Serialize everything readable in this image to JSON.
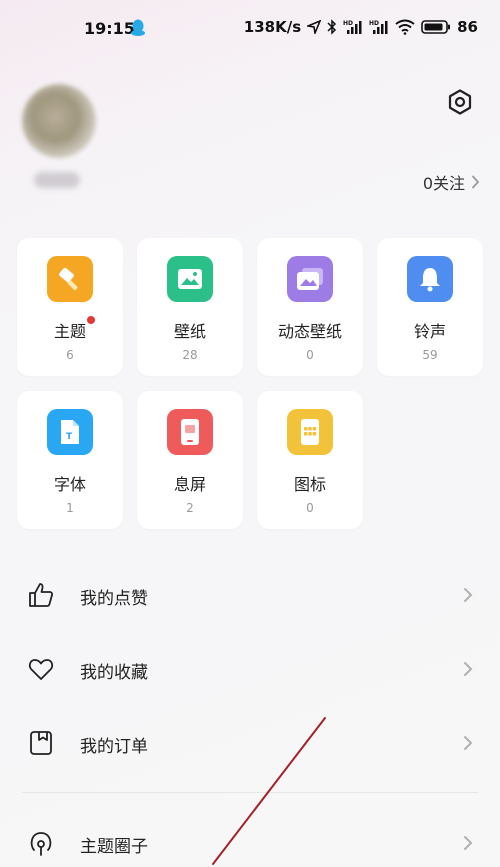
{
  "status_bar": {
    "time": "19:15",
    "net_speed": "138K/s",
    "battery": "86",
    "icons": [
      "qq-icon",
      "location-icon",
      "bluetooth-icon",
      "signal-hd-icon",
      "signal-hd-icon",
      "wifi-icon",
      "battery-icon"
    ]
  },
  "profile": {
    "follow_text": "0关注"
  },
  "categories": [
    {
      "label": "主题",
      "count": "6",
      "color": "#f5a623",
      "icon": "theme-brush-icon",
      "has_dot": true
    },
    {
      "label": "壁纸",
      "count": "28",
      "color": "#2bbf8a",
      "icon": "wallpaper-icon"
    },
    {
      "label": "动态壁纸",
      "count": "0",
      "color": "#9d7ce6",
      "icon": "live-wallpaper-icon"
    },
    {
      "label": "铃声",
      "count": "59",
      "color": "#4f8ef0",
      "icon": "bell-icon"
    },
    {
      "label": "字体",
      "count": "1",
      "color": "#2aa7f2",
      "icon": "font-icon"
    },
    {
      "label": "息屏",
      "count": "2",
      "color": "#ef5b5b",
      "icon": "aod-icon"
    },
    {
      "label": "图标",
      "count": "0",
      "color": "#f2c23a",
      "icon": "app-icons-icon"
    }
  ],
  "menu": [
    {
      "label": "我的点赞",
      "icon": "thumbs-up-icon"
    },
    {
      "label": "我的收藏",
      "icon": "heart-icon"
    },
    {
      "label": "我的订单",
      "icon": "order-icon"
    },
    {
      "label": "主题圈子",
      "icon": "circle-community-icon"
    }
  ],
  "colors": {
    "annotation_line": "#a3222a"
  }
}
